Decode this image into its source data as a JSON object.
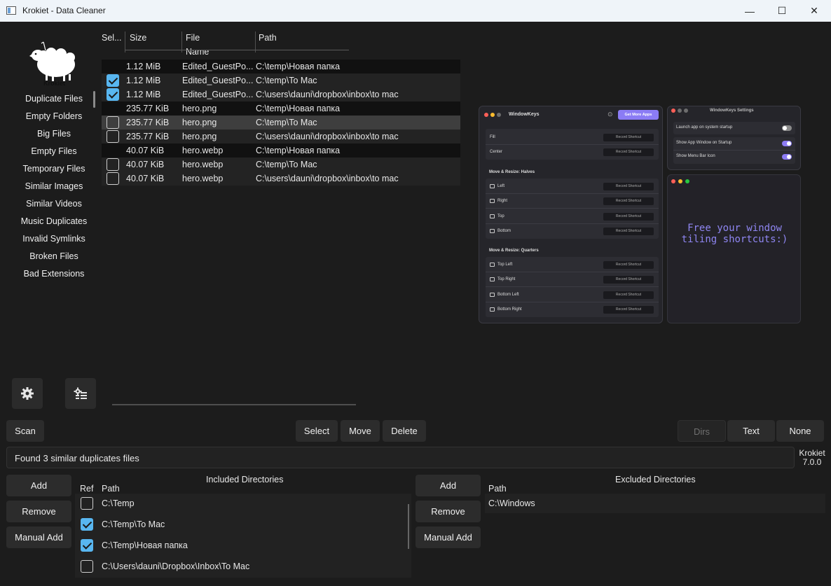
{
  "window": {
    "title": "Krokiet - Data Cleaner",
    "controls": {
      "minimize": "—",
      "maximize": "☐",
      "close": "✕"
    }
  },
  "logo": {
    "text": "Krokiet"
  },
  "sidebar": {
    "items": [
      {
        "label": "Duplicate Files"
      },
      {
        "label": "Empty Folders"
      },
      {
        "label": "Big Files"
      },
      {
        "label": "Empty Files"
      },
      {
        "label": "Temporary Files"
      },
      {
        "label": "Similar Images"
      },
      {
        "label": "Similar Videos"
      },
      {
        "label": "Music Duplicates"
      },
      {
        "label": "Invalid Symlinks"
      },
      {
        "label": "Broken Files"
      },
      {
        "label": "Bad Extensions"
      }
    ],
    "settings_icon": "gear-icon",
    "subsettings_icon": "sliders-gear-icon"
  },
  "results": {
    "columns": [
      "Sel...",
      "Size",
      "File Name",
      "Path"
    ],
    "rows": [
      {
        "header": true,
        "checked": false,
        "size": "1.12 MiB",
        "name": "Edited_GuestPo...",
        "path": "C:\\temp\\Новая папка"
      },
      {
        "header": false,
        "checked": true,
        "size": "1.12 MiB",
        "name": "Edited_GuestPo...",
        "path": "C:\\temp\\To Mac"
      },
      {
        "header": false,
        "checked": true,
        "size": "1.12 MiB",
        "name": "Edited_GuestPo...",
        "path": "C:\\users\\dauni\\dropbox\\inbox\\to mac"
      },
      {
        "header": true,
        "checked": false,
        "size": "235.77 KiB",
        "name": "hero.png",
        "path": "C:\\temp\\Новая папка"
      },
      {
        "header": false,
        "checked": false,
        "size": "235.77 KiB",
        "name": "hero.png",
        "path": "C:\\temp\\To Mac",
        "selected": true
      },
      {
        "header": false,
        "checked": false,
        "size": "235.77 KiB",
        "name": "hero.png",
        "path": "C:\\users\\dauni\\dropbox\\inbox\\to mac"
      },
      {
        "header": true,
        "checked": false,
        "size": "40.07 KiB",
        "name": "hero.webp",
        "path": "C:\\temp\\Новая папка"
      },
      {
        "header": false,
        "checked": false,
        "size": "40.07 KiB",
        "name": "hero.webp",
        "path": "C:\\temp\\To Mac"
      },
      {
        "header": false,
        "checked": false,
        "size": "40.07 KiB",
        "name": "hero.webp",
        "path": "C:\\users\\dauni\\dropbox\\inbox\\to mac"
      }
    ]
  },
  "preview": {
    "main_title": "WindowKeys",
    "get_more": "Get More Apps",
    "record": "Record Shortcut",
    "fill": "Fill",
    "center": "Center",
    "halves_title": "Move & Resize: Halves",
    "left": "Left",
    "right": "Right",
    "top": "Top",
    "bottom": "Bottom",
    "quarters_title": "Move & Resize: Quarters",
    "top_left": "Top Left",
    "top_right": "Top Right",
    "bottom_left": "Bottom Left",
    "bottom_right": "Bottom Right",
    "settings_title": "WindowKeys Settings",
    "launch": "Launch app on system startup",
    "show_app": "Show App Window on Startup",
    "show_menu": "Show Menu Bar Icon",
    "note_line1": "Free your window",
    "note_line2": "tiling shortcuts:)"
  },
  "actions": {
    "scan": "Scan",
    "select": "Select",
    "move": "Move",
    "delete": "Delete",
    "dirs": "Dirs",
    "text": "Text",
    "none": "None"
  },
  "status": {
    "message": "Found 3 similar duplicates files",
    "app_name": "Krokiet",
    "version": "7.0.0"
  },
  "included": {
    "title": "Included Directories",
    "add": "Add",
    "remove": "Remove",
    "manual_add": "Manual Add",
    "col_ref": "Ref",
    "col_path": "Path",
    "rows": [
      {
        "ref": false,
        "path": "C:\\Temp"
      },
      {
        "ref": true,
        "path": "C:\\Temp\\To Mac"
      },
      {
        "ref": true,
        "path": "C:\\Temp\\Новая папка"
      },
      {
        "ref": false,
        "path": "C:\\Users\\dauni\\Dropbox\\Inbox\\To Mac"
      }
    ]
  },
  "excluded": {
    "title": "Excluded Directories",
    "add": "Add",
    "remove": "Remove",
    "manual_add": "Manual Add",
    "col_path": "Path",
    "rows": [
      {
        "path": "C:\\Windows"
      }
    ]
  }
}
